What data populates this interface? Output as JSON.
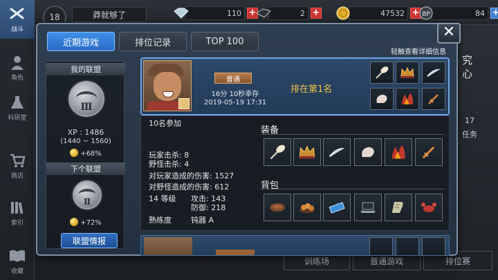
{
  "topbar": {
    "level": "18",
    "player_name": "莽就够了",
    "resources": [
      {
        "icon": "diamond-icon",
        "value": "110"
      },
      {
        "icon": "ticket-icon",
        "value": "2"
      },
      {
        "icon": "gold-coin-icon",
        "value": "47532"
      },
      {
        "icon": "bp-icon",
        "value": "84"
      }
    ]
  },
  "nav": [
    {
      "label": "战斗",
      "icon": "crossed-guns-icon",
      "active": true
    },
    {
      "label": "角色",
      "icon": "character-icon",
      "active": false
    },
    {
      "label": "科研室",
      "icon": "flask-icon",
      "active": false
    },
    {
      "label": "商店",
      "icon": "cart-icon",
      "active": false
    },
    {
      "label": "索引",
      "icon": "books-icon",
      "active": false
    },
    {
      "label": "收藏",
      "icon": "open-book-icon",
      "active": false
    }
  ],
  "background": {
    "training_label": "训练场",
    "normal_game_label": "普通游戏",
    "ranked_label": "排位赛",
    "side_text_1": "究",
    "side_text_2": "心",
    "side_number": "17",
    "side_task": "任务"
  },
  "modal": {
    "tabs": [
      "近期游戏",
      "排位记录",
      "TOP 100"
    ],
    "active_tab": 0,
    "hint": "轻触查看详细信息",
    "close_label": "✕"
  },
  "alliance": {
    "my_header": "我的联盟",
    "my_tier": "Ⅲ",
    "xp": "XP : 1486",
    "xp_range": "(1440 ~ 1560)",
    "my_bonus": "+68%",
    "next_header": "下个联盟",
    "next_tier": "Ⅱ",
    "next_bonus": "+72%",
    "info_button": "联盟情报"
  },
  "match": {
    "mode": "普通",
    "survival": "16分 10秒幸存",
    "date": "2019-05-19 17:31",
    "rank": "排在第1名",
    "participants": "10名参加",
    "player_kills": "玩家击杀: 8",
    "wild_kills": "野怪击杀: 4",
    "player_damage": "对玩家造成的伤害: 1527",
    "wild_damage": "对野怪造成的伤害: 612",
    "level": "14 等级",
    "attack": "攻击: 143",
    "defense": "防御: 218",
    "proficiency_label": "熟练度",
    "proficiency_value": "钝器 A",
    "equipment_title": "装备",
    "bag_title": "背包",
    "card_equipment_icons": [
      "feather-weapon-icon",
      "crown-icon",
      "wing-icon",
      "glove-icon",
      "flame-boots-icon",
      "sword-icon"
    ],
    "equipment_icons": [
      "feather-weapon-icon",
      "crown-icon",
      "wing-icon",
      "glove-icon",
      "flame-boots-icon",
      "sword-icon"
    ],
    "bag_icons": [
      "steak-icon",
      "dumplings-icon",
      "battery-icon",
      "laptop-icon",
      "scroll-icon",
      "crab-icon"
    ]
  }
}
